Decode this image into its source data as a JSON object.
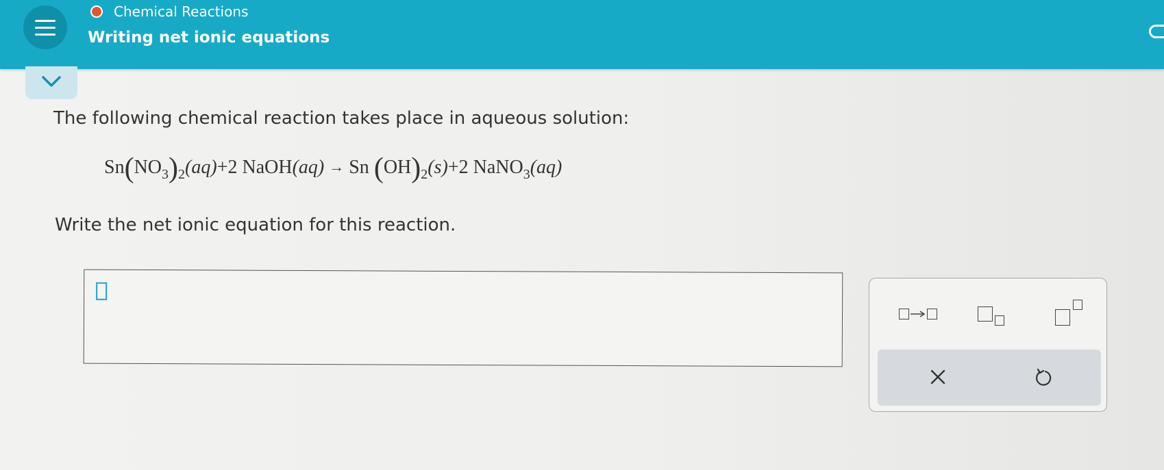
{
  "header": {
    "topic": "Chemical Reactions",
    "title": "Writing net ionic equations",
    "status_color": "#e4572e",
    "bar_color": "#17aac6"
  },
  "question": {
    "prompt": "The following chemical reaction takes place in aqueous solution:",
    "instruction": "Write the net ionic equation for this reaction.",
    "equation": {
      "r1_a": "Sn",
      "r1_b": "NO",
      "r1_sub3": "3",
      "r1_sub2": "2",
      "r1_state": "(aq)",
      "plus1": "+",
      "r2_coef": "2",
      "r2": "NaOH",
      "r2_state": "(aq)",
      "arrow": "→",
      "p1_a": "Sn",
      "p1_b": "OH",
      "p1_sub2": "2",
      "p1_state": "(s)",
      "plus2": "+",
      "p2_coef": "2",
      "p2_a": "NaNO",
      "p2_sub3": "3",
      "p2_state": "(aq)"
    }
  },
  "answer": {
    "value": ""
  },
  "palette": {
    "tools": [
      "reaction-arrow-icon",
      "subscript-icon",
      "superscript-icon"
    ],
    "actions": [
      "clear-icon",
      "undo-icon"
    ]
  }
}
